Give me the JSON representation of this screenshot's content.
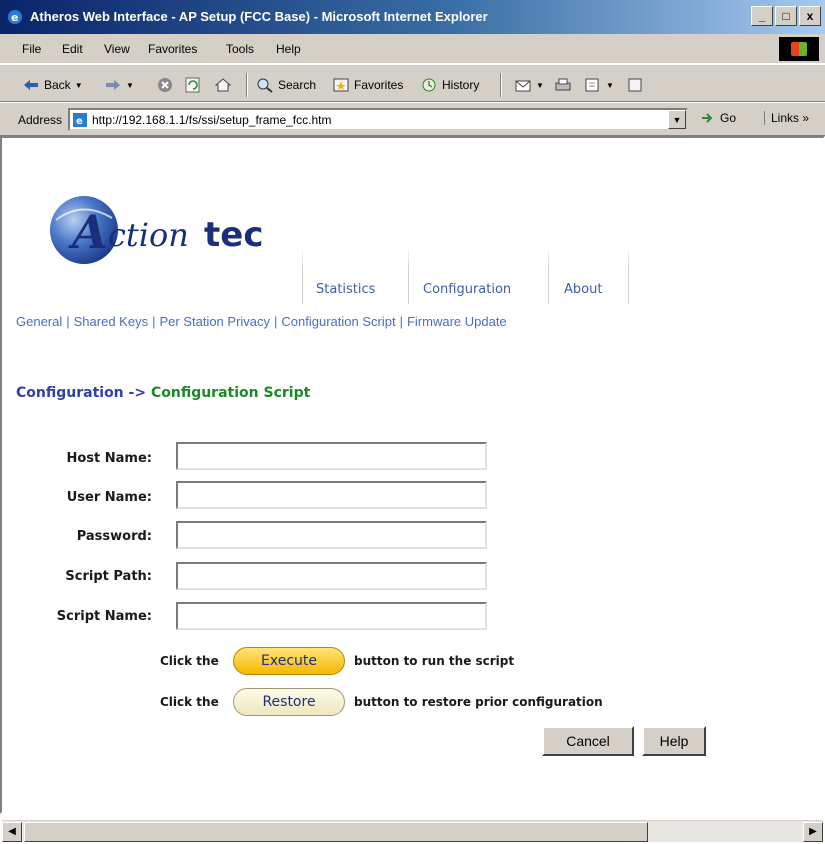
{
  "window": {
    "title": "Atheros Web Interface - AP Setup (FCC Base) - Microsoft Internet Explorer",
    "controls": [
      "_",
      "□",
      "x"
    ]
  },
  "menu": [
    "File",
    "Edit",
    "View",
    "Favorites",
    "Tools",
    "Help"
  ],
  "toolbar": {
    "back": "Back",
    "search": "Search",
    "favorites": "Favorites",
    "history": "History"
  },
  "address": {
    "label": "Address",
    "url": "http://192.168.1.1/fs/ssi/setup_frame_fcc.htm",
    "go": "Go",
    "links": "Links »"
  },
  "logo": {
    "text_a": "A",
    "text_ction": "ction",
    "text_tec": "tec"
  },
  "tabs": [
    "Statistics",
    "Configuration",
    "About"
  ],
  "subnav": [
    "General",
    "Shared Keys",
    "Per Station Privacy",
    "Configuration Script",
    "Firmware Update"
  ],
  "breadcrumb": {
    "section": "Configuration",
    "arrow": "->",
    "page": "Configuration Script"
  },
  "form": {
    "fields": [
      {
        "label": "Host Name:",
        "value": ""
      },
      {
        "label": "User Name:",
        "value": ""
      },
      {
        "label": "Password:",
        "value": ""
      },
      {
        "label": "Script Path:",
        "value": ""
      },
      {
        "label": "Script Name:",
        "value": ""
      }
    ]
  },
  "instructions": {
    "click_the": "Click the",
    "execute_label": "Execute",
    "execute_suffix": "button to run the script",
    "restore_label": "Restore",
    "restore_suffix": "button to restore prior configuration"
  },
  "buttons": {
    "cancel": "Cancel",
    "help": "Help"
  },
  "colors": {
    "tab_text": "#3e5ea7",
    "breadcrumb_section": "#2f3fb0",
    "breadcrumb_page": "#1a8a27",
    "execute_fill": "#f5b800",
    "restore_fill": "#eee6c0"
  }
}
